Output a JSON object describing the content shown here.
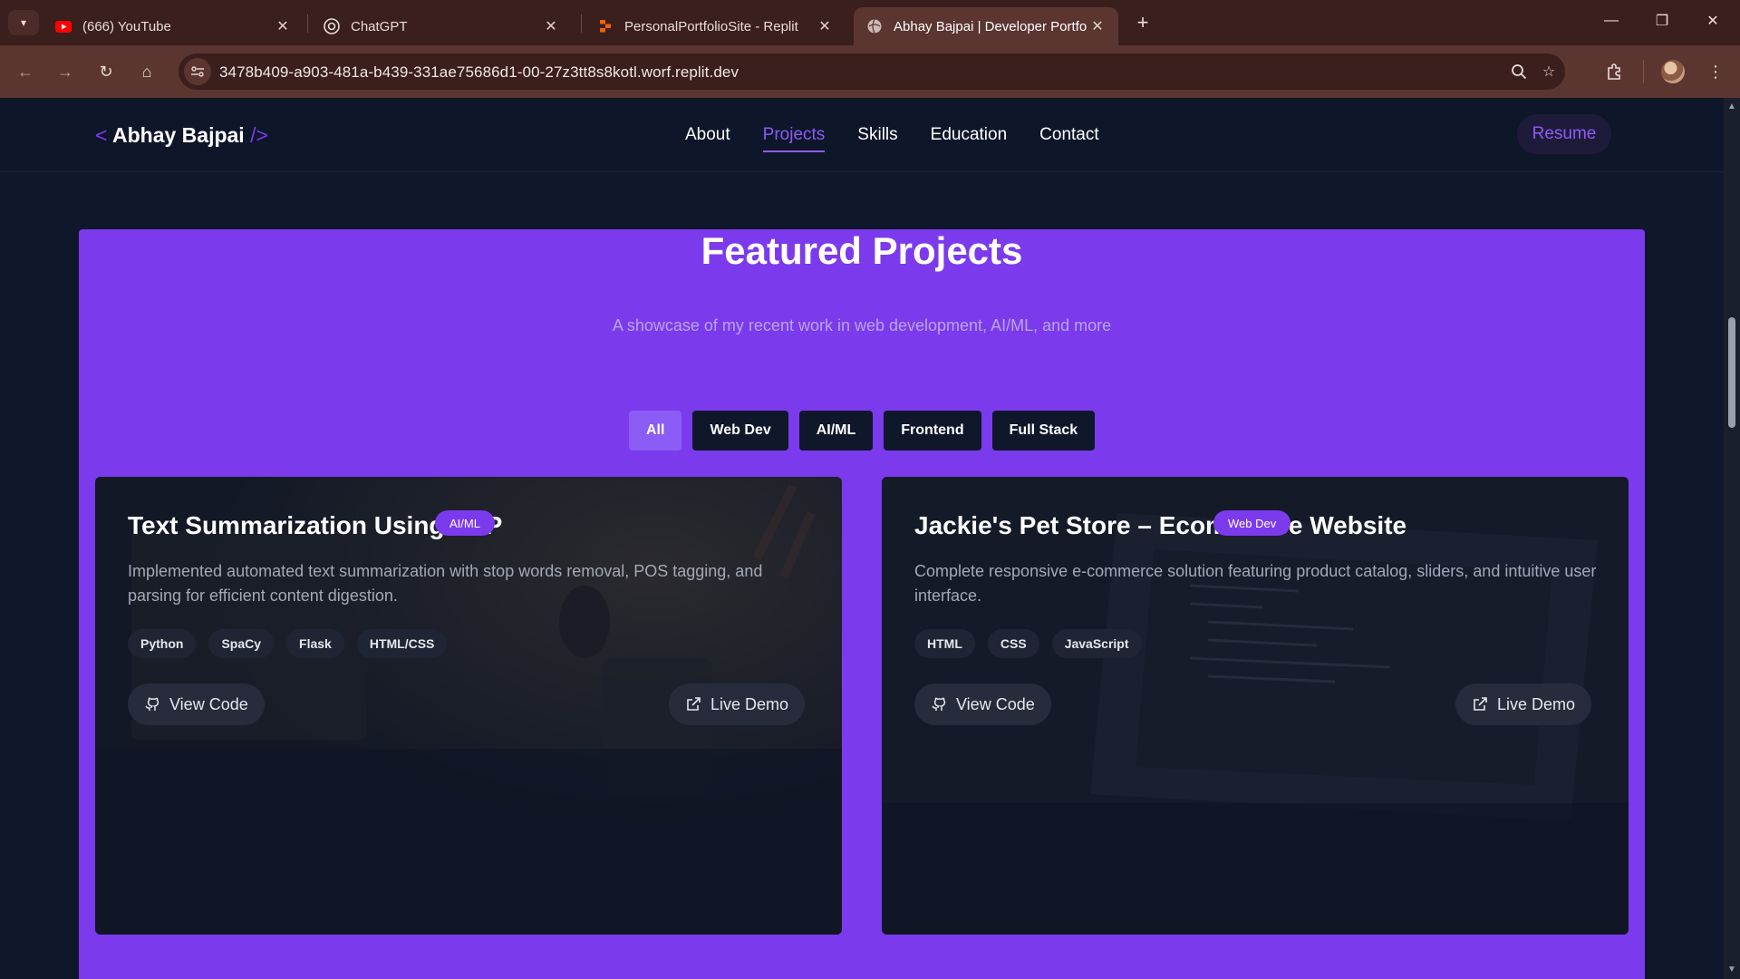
{
  "browser": {
    "tabs": [
      {
        "title": "(666) YouTube",
        "icon": "youtube-icon"
      },
      {
        "title": "ChatGPT",
        "icon": "chatgpt-icon"
      },
      {
        "title": "PersonalPortfolioSite - Replit",
        "icon": "replit-icon"
      },
      {
        "title": "Abhay Bajpai | Developer Portfo",
        "icon": "globe-icon",
        "active": true
      }
    ],
    "url": "3478b409-a903-481a-b439-331ae75686d1-00-27z3tt8s8kotl.worf.replit.dev"
  },
  "site": {
    "logo_open": "<",
    "logo_name": "Abhay Bajpai",
    "logo_close": "/>",
    "nav": [
      "About",
      "Projects",
      "Skills",
      "Education",
      "Contact"
    ],
    "active_nav": "Projects",
    "resume_label": "Resume"
  },
  "projects": {
    "title": "Featured Projects",
    "subtitle": "A showcase of my recent work in web development, AI/ML, and more",
    "filters": [
      "All",
      "Web Dev",
      "AI/ML",
      "Frontend",
      "Full Stack"
    ],
    "active_filter": "All",
    "cards": [
      {
        "title": "Text Summarization Using NLP",
        "badge": "AI/ML",
        "description": "Implemented automated text summarization with stop words removal, POS tagging, and parsing for efficient content digestion.",
        "tags": [
          "Python",
          "SpaCy",
          "Flask",
          "HTML/CSS"
        ],
        "code_label": "View Code",
        "demo_label": "Live Demo"
      },
      {
        "title": "Jackie's Pet Store – Ecommerce Website",
        "badge": "Web Dev",
        "description": "Complete responsive e-commerce solution featuring product catalog, sliders, and intuitive user interface.",
        "tags": [
          "HTML",
          "CSS",
          "JavaScript"
        ],
        "code_label": "View Code",
        "demo_label": "Live Demo"
      }
    ]
  },
  "colors": {
    "accent": "#7c3aed",
    "accent_light": "#8b5cf6",
    "page_bg": "#0f172a",
    "chrome": "#5b3530"
  }
}
